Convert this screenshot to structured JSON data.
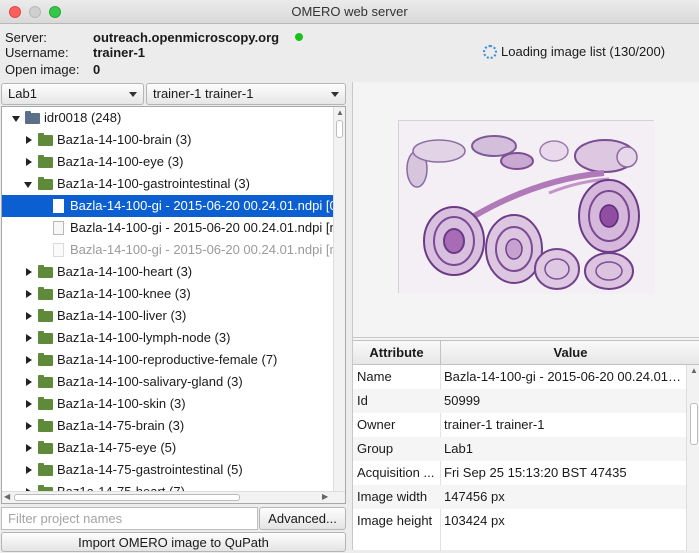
{
  "window": {
    "title": "OMERO web server"
  },
  "info": {
    "server_label": "Server:",
    "server_value": "outreach.openmicroscopy.org",
    "username_label": "Username:",
    "username_value": "trainer-1",
    "open_image_label": "Open image:",
    "open_image_value": "0",
    "loading_text": "Loading image list (130/200)",
    "status_color": "#19c219"
  },
  "filters": {
    "group": "Lab1",
    "owner": "trainer-1 trainer-1"
  },
  "tree": {
    "root": "idr0018 (248)",
    "datasets": [
      "Baz1a-14-100-brain (3)",
      "Baz1a-14-100-eye (3)",
      "Baz1a-14-100-gastrointestinal (3)",
      "Baz1a-14-100-heart (3)",
      "Baz1a-14-100-knee (3)",
      "Baz1a-14-100-liver (3)",
      "Baz1a-14-100-lymph-node (3)",
      "Baz1a-14-100-reproductive-female (7)",
      "Baz1a-14-100-salivary-gland (3)",
      "Baz1a-14-100-skin (3)",
      "Baz1a-14-75-brain (3)",
      "Baz1a-14-75-eye (5)",
      "Baz1a-14-75-gastrointestinal (5)",
      "Baz1a-14-75-heart (7)"
    ],
    "images": [
      "Bazla-14-100-gi - 2015-06-20 00.24.01.ndpi [0",
      "Bazla-14-100-gi - 2015-06-20 00.24.01.ndpi [m",
      "Bazla-14-100-gi - 2015-06-20 00.24.01.ndpi [m"
    ]
  },
  "bottom": {
    "filter_placeholder": "Filter project names",
    "advanced_label": "Advanced...",
    "import_label": "Import OMERO image to QuPath"
  },
  "table": {
    "headers": [
      "Attribute",
      "Value"
    ],
    "rows": [
      [
        "Name",
        "Bazla-14-100-gi - 2015-06-20 00.24.01.n..."
      ],
      [
        "Id",
        "50999"
      ],
      [
        "Owner",
        "trainer-1 trainer-1"
      ],
      [
        "Group",
        "Lab1"
      ],
      [
        "Acquisition ...",
        "Fri Sep 25 15:13:20 BST 47435"
      ],
      [
        "Image width",
        "147456 px"
      ],
      [
        "Image height",
        "103424 px"
      ]
    ]
  },
  "colors": {
    "selection": "#0b5fd1",
    "folder": "#5f8a3a"
  }
}
